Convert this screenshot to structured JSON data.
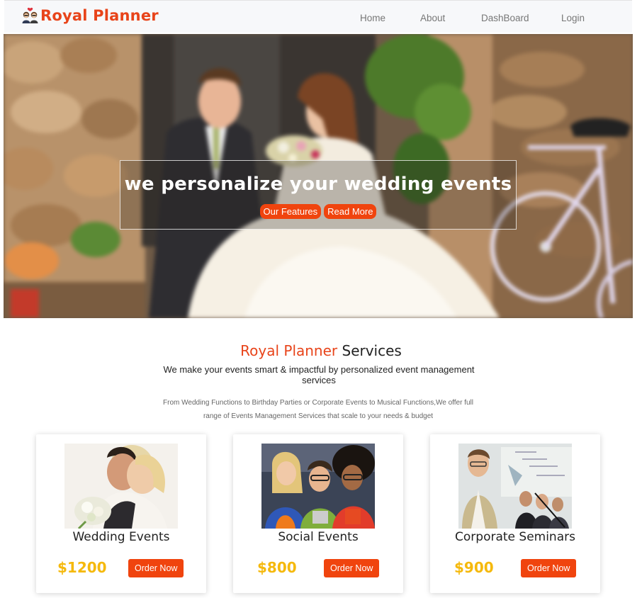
{
  "navbar": {
    "brand": "Royal Planner",
    "logo_icon": "couple-icon",
    "links": [
      "Home",
      "About",
      "DashBoard",
      "Login"
    ]
  },
  "hero": {
    "title": "we personalize your wedding events",
    "buttons": [
      "Our Features",
      "Read More"
    ]
  },
  "services": {
    "title_accent": "Royal Planner",
    "title_rest": " Services",
    "subtitle": "We make your events smart & impactful by personalized event management services",
    "description": "From Wedding Functions to Birthday Parties or Corporate Events to Musical Functions,We offer full range of Events Management Services that scale to your needs & budget"
  },
  "cards": [
    {
      "title": "Wedding Events",
      "price": "$1200",
      "button": "Order Now"
    },
    {
      "title": "Social Events",
      "price": "$800",
      "button": "Order Now"
    },
    {
      "title": "Corporate Seminars",
      "price": "$900",
      "button": "Order Now"
    }
  ],
  "colors": {
    "brand": "#e8441a",
    "button": "#f0440e",
    "price": "#f5b90d"
  }
}
